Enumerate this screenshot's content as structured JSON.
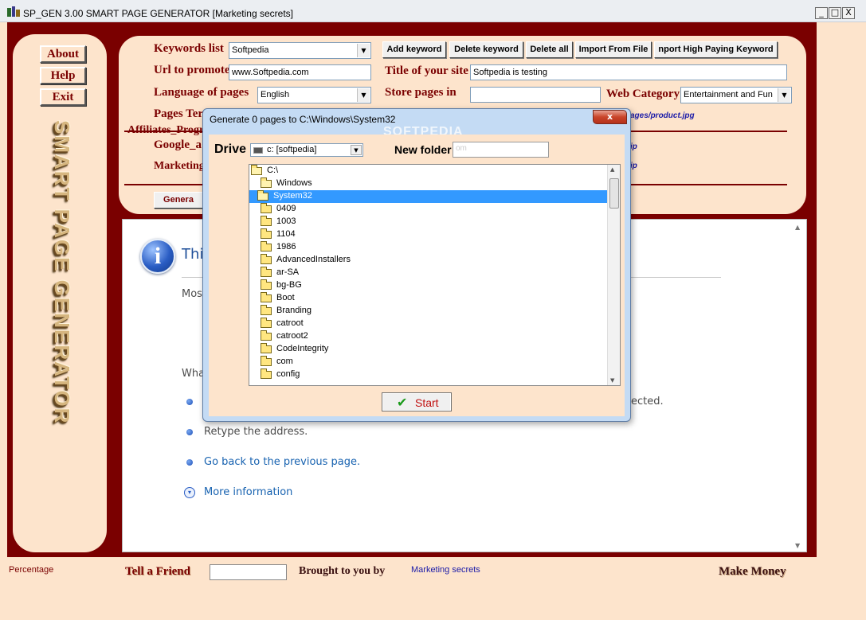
{
  "window": {
    "title": "SP_GEN 3.00 SMART PAGE GENERATOR [Marketing secrets]",
    "min_glyph": "_",
    "max_glyph": "□",
    "close_glyph": "X"
  },
  "sidebar": {
    "about": "About",
    "help": "Help",
    "exit": "Exit",
    "logo_text": "SMART PAGE GENERATOR"
  },
  "form": {
    "keywords_label": "Keywords list",
    "keywords_value": "Softpedia",
    "url_label": "Url to promote",
    "url_value": "www.Softpedia.com",
    "language_label": "Language of pages",
    "language_value": "English",
    "pages_template_label": "Pages Ter",
    "affiliates_label": "Affiliates_Progra",
    "google_label": "Google_a",
    "marketing_label": "Marketing",
    "generate_button": "Genera",
    "title_label": "Title of your site",
    "title_value": "Softpedia is testing",
    "store_label": "Store pages in",
    "store_value": "",
    "category_label": "Web Category",
    "category_value": "Entertainment and Fun",
    "image_path": "ages/product.jpg",
    "link_1": "ip",
    "link_2": "ip",
    "buttons": {
      "add_keyword": "Add keyword",
      "delete_keyword": "Delete keyword",
      "delete_all": "Delete all",
      "import_from_file": "Import From File",
      "import_high_paying": "nport High Paying Keyword"
    }
  },
  "ie_page": {
    "icon_glyph": "i",
    "heading": "This",
    "line_1": "Mos",
    "line_2": "Wha",
    "bullet_1_tail": "ected.",
    "bullet_2": "Retype the address.",
    "bullet_3": "Go back to the previous page.",
    "more_info": "More information",
    "expand_glyph": "▾"
  },
  "bottom": {
    "percentage": "Percentage",
    "tell_friend": "Tell a Friend",
    "brought_by": "Brought to you by",
    "brand_link": "Marketing secrets",
    "make_money": "Make Money"
  },
  "dialog": {
    "title": "Generate 0 pages to C:\\Windows\\System32",
    "watermark": "SOFTPEDIA",
    "close_glyph": "x",
    "drive_label": "Drive",
    "drive_value": "c: [softpedia]",
    "new_folder_label": "New folder",
    "new_folder_value": "om",
    "start_button": "Start",
    "check_glyph": "✔",
    "tree": [
      {
        "label": "C:\\",
        "level": 0,
        "open": true
      },
      {
        "label": "Windows",
        "level": 1,
        "open": true
      },
      {
        "label": "System32",
        "level": 2,
        "open": true,
        "selected": true
      },
      {
        "label": "0409",
        "level": 3
      },
      {
        "label": "1003",
        "level": 3
      },
      {
        "label": "1104",
        "level": 3
      },
      {
        "label": "1986",
        "level": 3
      },
      {
        "label": "AdvancedInstallers",
        "level": 3
      },
      {
        "label": "ar-SA",
        "level": 3
      },
      {
        "label": "bg-BG",
        "level": 3
      },
      {
        "label": "Boot",
        "level": 3
      },
      {
        "label": "Branding",
        "level": 3
      },
      {
        "label": "catroot",
        "level": 3
      },
      {
        "label": "catroot2",
        "level": 3
      },
      {
        "label": "CodeIntegrity",
        "level": 3
      },
      {
        "label": "com",
        "level": 3
      },
      {
        "label": "config",
        "level": 3
      }
    ]
  }
}
